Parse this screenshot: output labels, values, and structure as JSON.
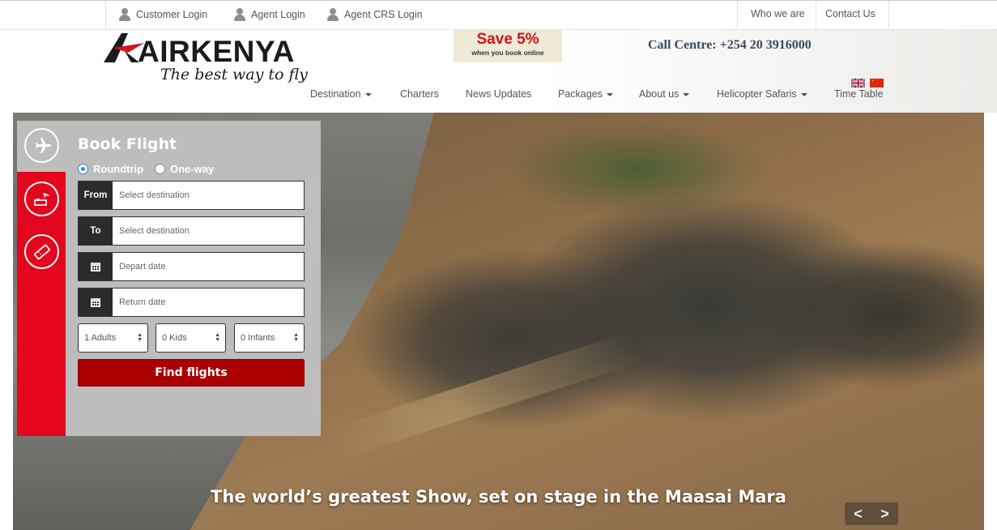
{
  "topbar": {
    "customer_login": "Customer Login",
    "agent_login": "Agent Login",
    "agent_crs_login": "Agent CRS Login",
    "who_we_are": "Who we are",
    "contact_us": "Contact Us"
  },
  "header": {
    "logo_text": "AIRKENYA",
    "logo_tagline": "The best way to fly",
    "promo_big": "Save 5%",
    "promo_small": "when you book online",
    "call_centre": "Call Centre: +254 20 3916000",
    "languages": [
      "english-flag-icon",
      "chinese-flag-icon"
    ]
  },
  "nav": {
    "items": [
      {
        "label": "Destination",
        "dropdown": true
      },
      {
        "label": "Charters",
        "dropdown": false
      },
      {
        "label": "News Updates",
        "dropdown": false
      },
      {
        "label": "Packages",
        "dropdown": true
      },
      {
        "label": "About us",
        "dropdown": true
      },
      {
        "label": "Helicopter Safaris",
        "dropdown": true
      },
      {
        "label": "Time Table",
        "dropdown": false
      }
    ]
  },
  "booking": {
    "title": "Book Flight",
    "trip_types": [
      "Roundtrip",
      "One-way"
    ],
    "selected_trip": "Roundtrip",
    "from_label": "From",
    "from_placeholder": "Select destination",
    "to_label": "To",
    "to_placeholder": "Select destination",
    "depart_placeholder": "Depart date",
    "return_placeholder": "Return date",
    "adults": "1 Adults",
    "kids": "0 Kids",
    "infants": "0 Infants",
    "submit": "Find flights",
    "tabs": [
      "plane-icon",
      "hotel-flight-icon",
      "ticket-icon"
    ]
  },
  "hero": {
    "caption": "The world’s greatest Show, set on stage in the Maasai Mara",
    "prev": "<",
    "next": ">"
  },
  "colors": {
    "brand_red": "#e3061c",
    "button_red": "#ac0000",
    "panel_grey": "#bdbdbd"
  }
}
